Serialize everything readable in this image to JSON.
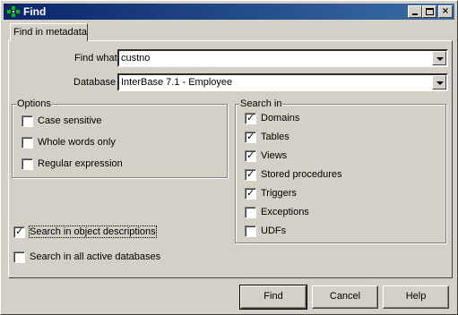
{
  "window": {
    "title": "Find"
  },
  "tabs": [
    {
      "label": "Find in metadata"
    }
  ],
  "find_what": {
    "label": "Find what",
    "value": "custno"
  },
  "database": {
    "label": "Database",
    "value": "InterBase 7.1 - Employee"
  },
  "options": {
    "title": "Options",
    "items": [
      {
        "label": "Case sensitive",
        "checked": false
      },
      {
        "label": "Whole words only",
        "checked": false
      },
      {
        "label": "Regular expression",
        "checked": false
      }
    ]
  },
  "search_in": {
    "title": "Search in",
    "items": [
      {
        "label": "Domains",
        "checked": true
      },
      {
        "label": "Tables",
        "checked": true
      },
      {
        "label": "Views",
        "checked": true
      },
      {
        "label": "Stored procedures",
        "checked": true
      },
      {
        "label": "Triggers",
        "checked": true
      },
      {
        "label": "Exceptions",
        "checked": false
      },
      {
        "label": "UDFs",
        "checked": false
      }
    ]
  },
  "extra": {
    "object_descriptions": {
      "label": "Search in object descriptions",
      "checked": true
    },
    "all_databases": {
      "label": "Search in all active databases",
      "checked": false
    }
  },
  "buttons": {
    "find": "Find",
    "cancel": "Cancel",
    "help": "Help"
  },
  "icons": {
    "title": "find-app-icon",
    "combo_arrow": "chevron-down-icon",
    "check": "checkmark-icon"
  },
  "colors": {
    "titlebar_start": "#0a246a",
    "titlebar_end": "#3a6ea5",
    "face": "#d4d0c8"
  }
}
